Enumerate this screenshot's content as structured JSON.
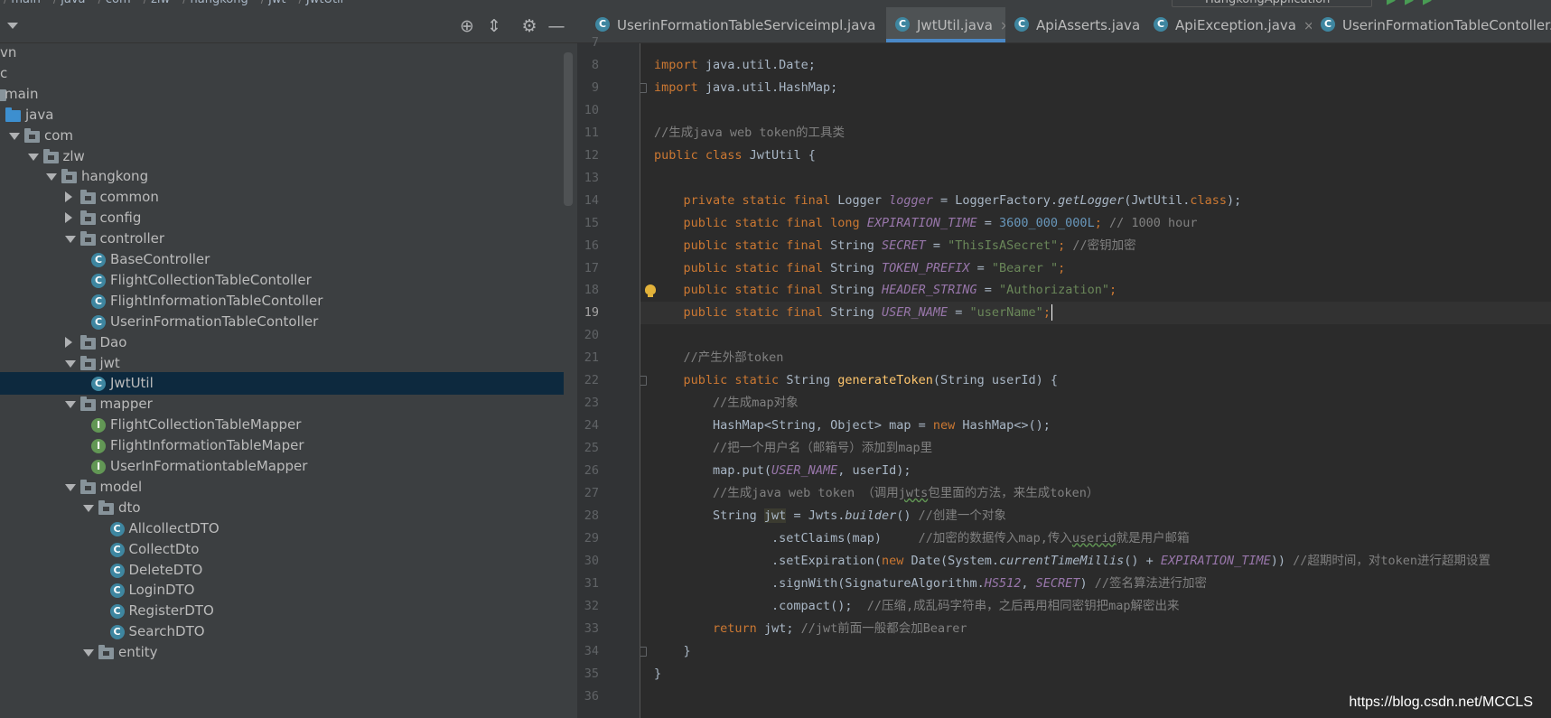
{
  "breadcrumb": {
    "items": [
      "main",
      "java",
      "com",
      "zlw",
      "hangkong",
      "jwt",
      "JwtUtil"
    ],
    "run_config": "HangkongApplication"
  },
  "project": {
    "tree": [
      {
        "label": "vn",
        "depth": 0,
        "type": "none",
        "arrow": "none"
      },
      {
        "label": "c",
        "depth": 0,
        "type": "none",
        "arrow": "none"
      },
      {
        "label": "main",
        "depth": 0,
        "type": "folder",
        "arrow": "none"
      },
      {
        "label": "java",
        "depth": 0,
        "type": "src",
        "arrow": "none"
      },
      {
        "label": "com",
        "depth": 0,
        "type": "pkg",
        "arrow": "down"
      },
      {
        "label": "zlw",
        "depth": 1,
        "type": "pkg",
        "arrow": "down"
      },
      {
        "label": "hangkong",
        "depth": 2,
        "type": "pkg",
        "arrow": "down"
      },
      {
        "label": "common",
        "depth": 3,
        "type": "pkg",
        "arrow": "right"
      },
      {
        "label": "config",
        "depth": 3,
        "type": "pkg",
        "arrow": "right"
      },
      {
        "label": "controller",
        "depth": 3,
        "type": "pkg",
        "arrow": "down"
      },
      {
        "label": "BaseController",
        "depth": 4,
        "type": "class",
        "arrow": "none"
      },
      {
        "label": "FlightCollectionTableContoller",
        "depth": 4,
        "type": "class",
        "arrow": "none"
      },
      {
        "label": "FlightInformationTableContoller",
        "depth": 4,
        "type": "class",
        "arrow": "none"
      },
      {
        "label": "UserinFormationTableContoller",
        "depth": 4,
        "type": "class",
        "arrow": "none"
      },
      {
        "label": "Dao",
        "depth": 3,
        "type": "pkg",
        "arrow": "right"
      },
      {
        "label": "jwt",
        "depth": 3,
        "type": "pkg",
        "arrow": "down"
      },
      {
        "label": "JwtUtil",
        "depth": 4,
        "type": "class",
        "arrow": "none",
        "selected": true
      },
      {
        "label": "mapper",
        "depth": 3,
        "type": "pkg",
        "arrow": "down"
      },
      {
        "label": "FlightCollectionTableMapper",
        "depth": 4,
        "type": "interface",
        "arrow": "none"
      },
      {
        "label": "FlightInformationTableMaper",
        "depth": 4,
        "type": "interface",
        "arrow": "none"
      },
      {
        "label": "UserInFormationtableMapper",
        "depth": 4,
        "type": "interface",
        "arrow": "none"
      },
      {
        "label": "model",
        "depth": 3,
        "type": "pkg",
        "arrow": "down"
      },
      {
        "label": "dto",
        "depth": 4,
        "type": "pkg",
        "arrow": "down"
      },
      {
        "label": "AllcollectDTO",
        "depth": 5,
        "type": "class",
        "arrow": "none"
      },
      {
        "label": "CollectDto",
        "depth": 5,
        "type": "class",
        "arrow": "none"
      },
      {
        "label": "DeleteDTO",
        "depth": 5,
        "type": "class",
        "arrow": "none"
      },
      {
        "label": "LoginDTO",
        "depth": 5,
        "type": "class",
        "arrow": "none"
      },
      {
        "label": "RegisterDTO",
        "depth": 5,
        "type": "class",
        "arrow": "none"
      },
      {
        "label": "SearchDTO",
        "depth": 5,
        "type": "class",
        "arrow": "none"
      },
      {
        "label": "entity",
        "depth": 4,
        "type": "pkg",
        "arrow": "down"
      }
    ]
  },
  "tabs": [
    {
      "label": "UserinFormationTableServiceimpl.java",
      "active": false
    },
    {
      "label": "JwtUtil.java",
      "active": true
    },
    {
      "label": "ApiAsserts.java",
      "active": false
    },
    {
      "label": "ApiException.java",
      "active": false
    },
    {
      "label": "UserinFormationTableContoller.java",
      "active": false
    }
  ],
  "editor": {
    "first_line": 7,
    "current_line": 19,
    "lines": [
      {
        "n": 7,
        "tokens": []
      },
      {
        "n": 8,
        "tokens": [
          [
            "k",
            "import "
          ],
          [
            "",
            "java.util.Date;"
          ]
        ]
      },
      {
        "n": 9,
        "fold": true,
        "tokens": [
          [
            "k",
            "import "
          ],
          [
            "",
            "java.util.HashMap;"
          ]
        ]
      },
      {
        "n": 10,
        "tokens": []
      },
      {
        "n": 11,
        "tokens": [
          [
            "cm",
            "//生成java web token的工具类"
          ]
        ]
      },
      {
        "n": 12,
        "tokens": [
          [
            "k",
            "public class "
          ],
          [
            "",
            "JwtUtil {"
          ]
        ]
      },
      {
        "n": 13,
        "tokens": []
      },
      {
        "n": 14,
        "tokens": [
          [
            "",
            "    "
          ],
          [
            "k",
            "private static final "
          ],
          [
            "",
            "Logger "
          ],
          [
            "f",
            "logger"
          ],
          [
            "",
            " = LoggerFactory."
          ],
          [
            "it",
            "getLogger"
          ],
          [
            "",
            "(JwtUtil."
          ],
          [
            "k",
            "class"
          ],
          [
            "",
            ");"
          ]
        ]
      },
      {
        "n": 15,
        "tokens": [
          [
            "",
            "    "
          ],
          [
            "k",
            "public static final long "
          ],
          [
            "f",
            "EXPIRATION_TIME"
          ],
          [
            "",
            " = "
          ],
          [
            "n",
            "3600_000_000L"
          ],
          [
            "k",
            "; "
          ],
          [
            "cm",
            "// 1000 hour"
          ]
        ]
      },
      {
        "n": 16,
        "tokens": [
          [
            "",
            "    "
          ],
          [
            "k",
            "public static final "
          ],
          [
            "",
            "String "
          ],
          [
            "f",
            "SECRET"
          ],
          [
            "",
            " = "
          ],
          [
            "s",
            "\"ThisIsASecret\""
          ],
          [
            "k",
            "; "
          ],
          [
            "cm",
            "//密钥加密"
          ]
        ]
      },
      {
        "n": 17,
        "tokens": [
          [
            "",
            "    "
          ],
          [
            "k",
            "public static final "
          ],
          [
            "",
            "String "
          ],
          [
            "f",
            "TOKEN_PREFIX"
          ],
          [
            "",
            " = "
          ],
          [
            "s",
            "\"Bearer \""
          ],
          [
            "k",
            ";"
          ]
        ]
      },
      {
        "n": 18,
        "bulb": true,
        "tokens": [
          [
            "",
            "    "
          ],
          [
            "k",
            "public static final "
          ],
          [
            "",
            "String "
          ],
          [
            "f",
            "HEADER_STRING"
          ],
          [
            "",
            " = "
          ],
          [
            "s",
            "\"Authorization\""
          ],
          [
            "k",
            ";"
          ]
        ]
      },
      {
        "n": 19,
        "tokens": [
          [
            "",
            "    "
          ],
          [
            "k",
            "public static final "
          ],
          [
            "",
            "String "
          ],
          [
            "f",
            "USER_NAME"
          ],
          [
            "",
            " = "
          ],
          [
            "s",
            "\"userName\""
          ],
          [
            "k",
            ";"
          ],
          [
            "caret",
            ""
          ]
        ]
      },
      {
        "n": 20,
        "tokens": []
      },
      {
        "n": 21,
        "tokens": [
          [
            "",
            "    "
          ],
          [
            "cm",
            "//产生外部token"
          ]
        ]
      },
      {
        "n": 22,
        "fold": true,
        "tokens": [
          [
            "",
            "    "
          ],
          [
            "k",
            "public static "
          ],
          [
            "",
            "String "
          ],
          [
            "fn",
            "generateToken"
          ],
          [
            "",
            "(String userId) {"
          ]
        ]
      },
      {
        "n": 23,
        "tokens": [
          [
            "",
            "        "
          ],
          [
            "cm",
            "//生成map对象"
          ]
        ]
      },
      {
        "n": 24,
        "tokens": [
          [
            "",
            "        HashMap<String, Object> map = "
          ],
          [
            "k",
            "new "
          ],
          [
            "",
            "HashMap<>();"
          ]
        ]
      },
      {
        "n": 25,
        "tokens": [
          [
            "",
            "        "
          ],
          [
            "cm",
            "//把一个用户名（邮箱号）添加到map里"
          ]
        ]
      },
      {
        "n": 26,
        "tokens": [
          [
            "",
            "        map.put("
          ],
          [
            "f",
            "USER_NAME"
          ],
          [
            "",
            ", userId);"
          ]
        ]
      },
      {
        "n": 27,
        "tokens": [
          [
            "",
            "        "
          ],
          [
            "cm",
            "//生成java web token （调用"
          ],
          [
            "cmuw",
            "jwts"
          ],
          [
            "cm",
            "包里面的方法，来生成token）"
          ]
        ]
      },
      {
        "n": 28,
        "tokens": [
          [
            "",
            "        String "
          ],
          [
            "hl",
            "jwt"
          ],
          [
            "",
            " = Jwts."
          ],
          [
            "it",
            "builder"
          ],
          [
            "",
            "() "
          ],
          [
            "cm",
            "//创建一个对象"
          ]
        ]
      },
      {
        "n": 29,
        "tokens": [
          [
            "",
            "                .setClaims(map)     "
          ],
          [
            "cm",
            "//加密的数据传入map,传入"
          ],
          [
            "cmuw",
            "userid"
          ],
          [
            "cm",
            "就是用户邮箱"
          ]
        ]
      },
      {
        "n": 30,
        "tokens": [
          [
            "",
            "                .setExpiration("
          ],
          [
            "k",
            "new "
          ],
          [
            "",
            "Date(System."
          ],
          [
            "it",
            "currentTimeMillis"
          ],
          [
            "",
            "() + "
          ],
          [
            "f",
            "EXPIRATION_TIME"
          ],
          [
            "",
            ")) "
          ],
          [
            "cm",
            "//超期时间，对token进行超期设置"
          ]
        ]
      },
      {
        "n": 31,
        "tokens": [
          [
            "",
            "                .signWith(SignatureAlgorithm."
          ],
          [
            "f",
            "HS512"
          ],
          [
            "",
            ", "
          ],
          [
            "f",
            "SECRET"
          ],
          [
            "",
            ") "
          ],
          [
            "cm",
            "//签名算法进行加密"
          ]
        ]
      },
      {
        "n": 32,
        "tokens": [
          [
            "",
            "                .compact();  "
          ],
          [
            "cm",
            "//压缩,成乱码字符串，之后再用相同密钥把map解密出来"
          ]
        ]
      },
      {
        "n": 33,
        "tokens": [
          [
            "",
            "        "
          ],
          [
            "k",
            "return "
          ],
          [
            "",
            "jwt; "
          ],
          [
            "cm",
            "//jwt前面一般都会加Bearer"
          ]
        ]
      },
      {
        "n": 34,
        "fold": true,
        "tokens": [
          [
            "",
            "    }"
          ]
        ]
      },
      {
        "n": 35,
        "tokens": [
          [
            "",
            "}"
          ]
        ]
      },
      {
        "n": 36,
        "tokens": []
      }
    ]
  },
  "watermark": "https://blog.csdn.net/MCCLS",
  "colors": {
    "selection": "#0d293e",
    "accent": "#4a88c7",
    "keyword": "#cc7832",
    "string": "#6a8759",
    "field": "#9876aa"
  }
}
